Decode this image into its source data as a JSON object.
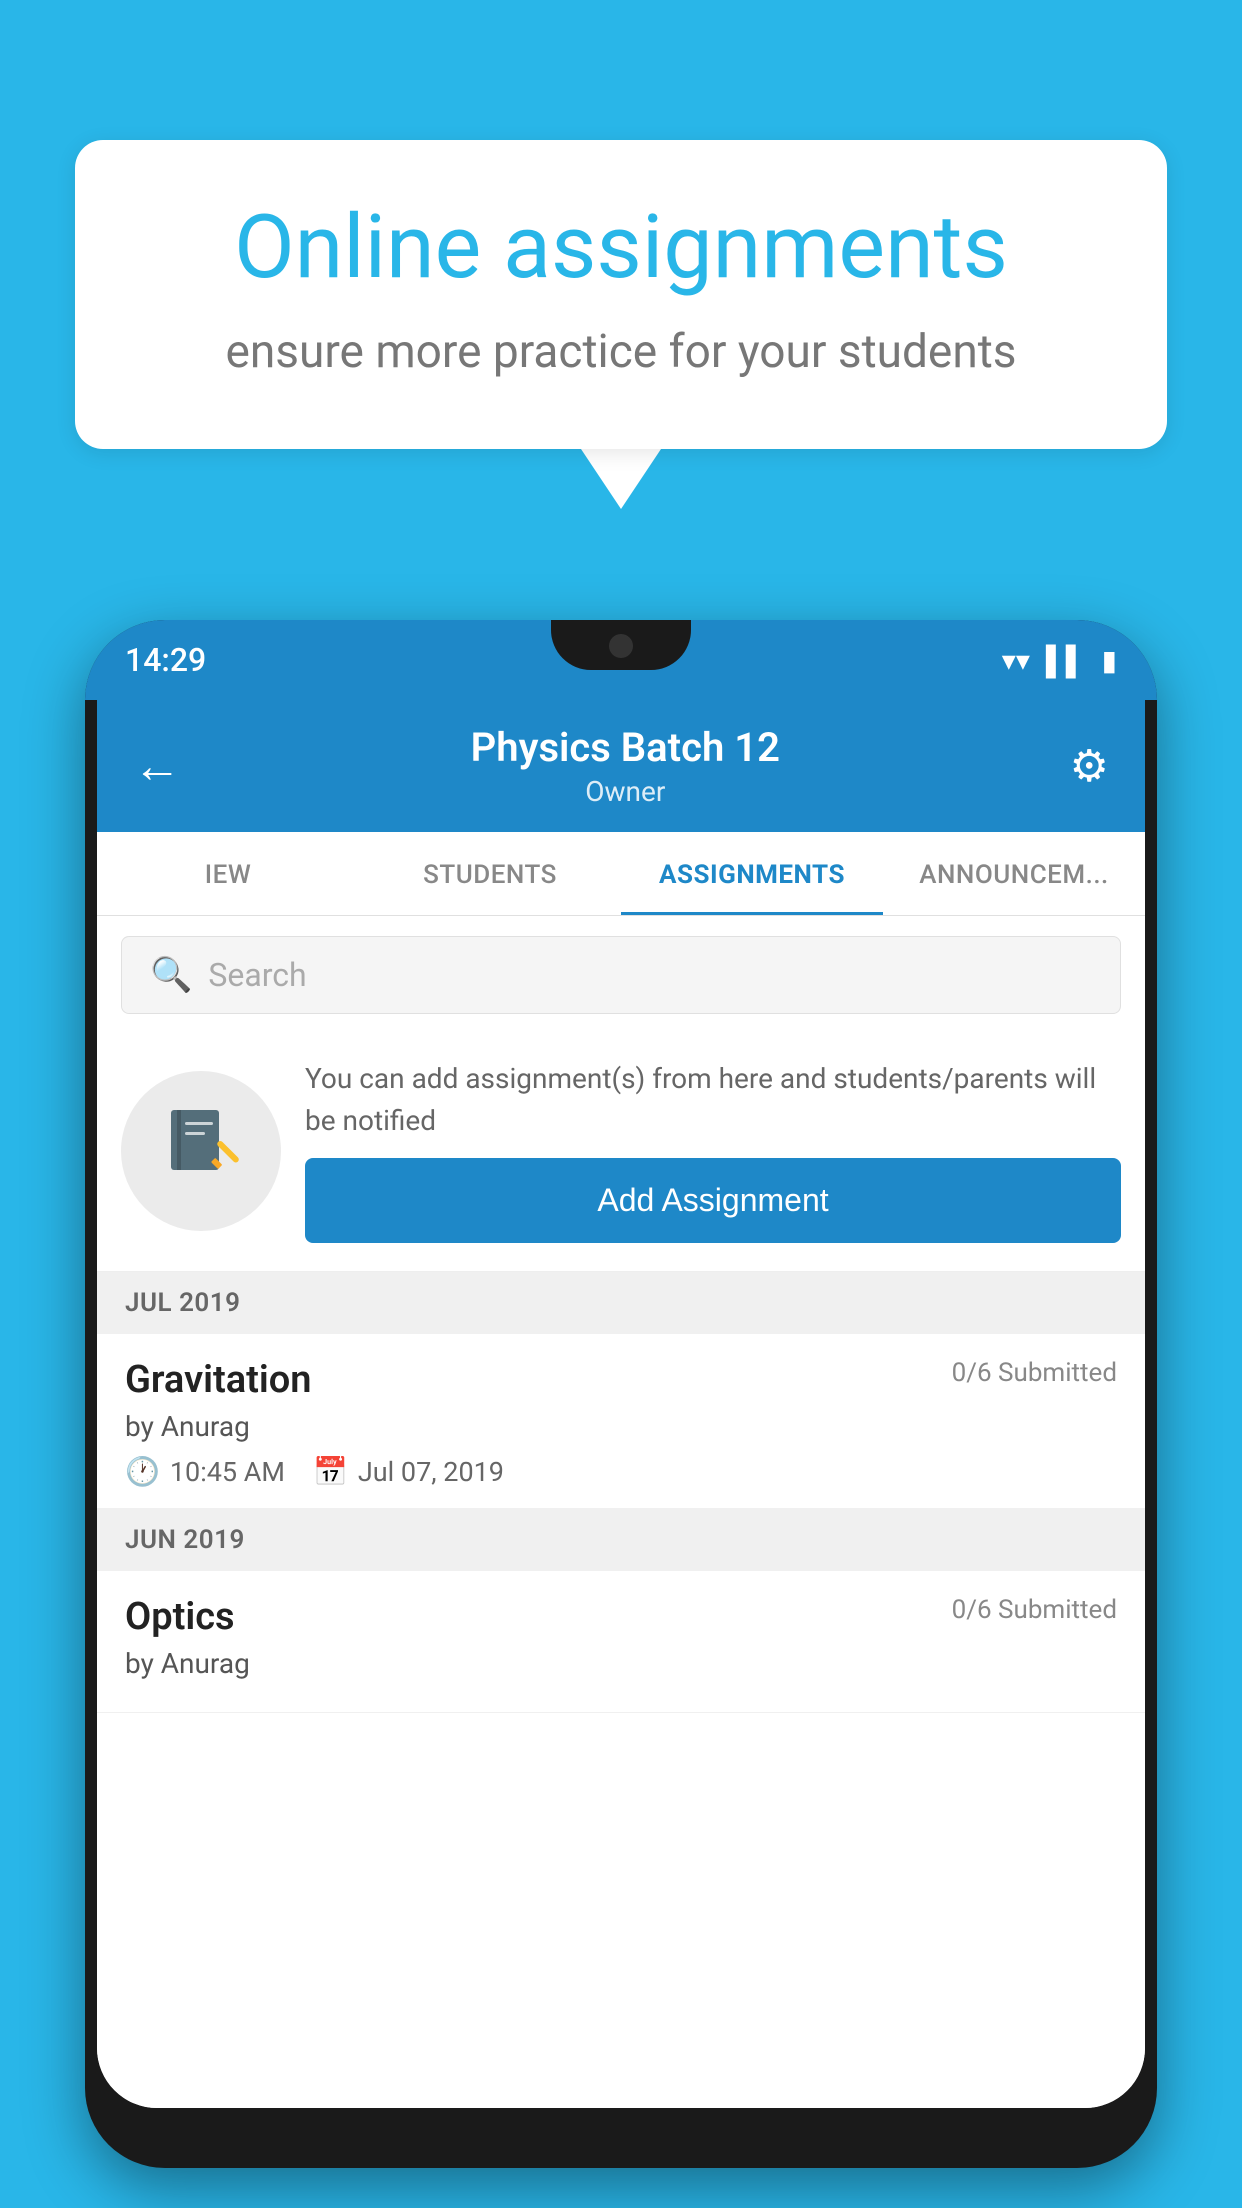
{
  "background": {
    "color": "#29b6e8"
  },
  "speech_bubble": {
    "title": "Online assignments",
    "subtitle": "ensure more practice for your students"
  },
  "phone": {
    "status_bar": {
      "time": "14:29",
      "icons": [
        "wifi",
        "signal",
        "battery"
      ]
    },
    "header": {
      "title": "Physics Batch 12",
      "subtitle": "Owner",
      "back_label": "←",
      "settings_label": "⚙"
    },
    "tabs": [
      {
        "label": "IEW",
        "active": false
      },
      {
        "label": "STUDENTS",
        "active": false
      },
      {
        "label": "ASSIGNMENTS",
        "active": true
      },
      {
        "label": "ANNOUNCEM...",
        "active": false
      }
    ],
    "search": {
      "placeholder": "Search"
    },
    "prompt": {
      "icon": "📓",
      "text": "You can add assignment(s) from here and students/parents will be notified",
      "button_label": "Add Assignment"
    },
    "assignment_sections": [
      {
        "month": "JUL 2019",
        "assignments": [
          {
            "name": "Gravitation",
            "submitted": "0/6 Submitted",
            "by": "by Anurag",
            "time": "10:45 AM",
            "date": "Jul 07, 2019"
          }
        ]
      },
      {
        "month": "JUN 2019",
        "assignments": [
          {
            "name": "Optics",
            "submitted": "0/6 Submitted",
            "by": "by Anurag",
            "time": "",
            "date": ""
          }
        ]
      }
    ]
  }
}
